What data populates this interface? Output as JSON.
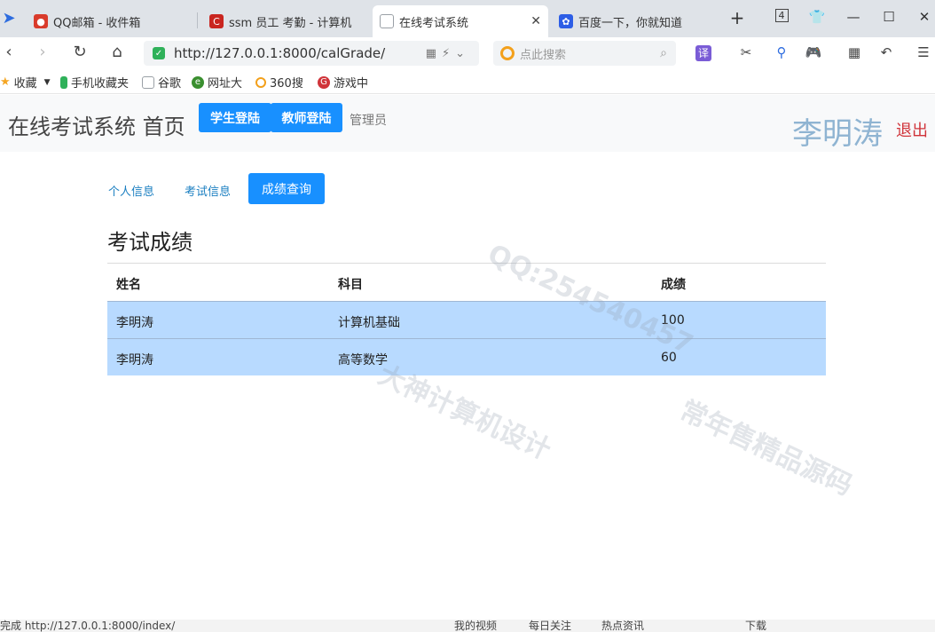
{
  "browser": {
    "tabs": [
      {
        "title": "QQ邮箱 - 收件箱",
        "icon": "qq-mail-icon",
        "color": "#d93b2b"
      },
      {
        "title": "ssm 员工 考勤 - 计算机",
        "icon": "csdn-icon",
        "color": "#c9251f"
      },
      {
        "title": "在线考试系统",
        "icon": "page-icon",
        "color": "#9aa0a6",
        "active": true
      },
      {
        "title": "百度一下，你就知道",
        "icon": "baidu-icon",
        "color": "#2d5ee6"
      }
    ],
    "tab_count": "4",
    "address_url": "http://127.0.0.1:8000/calGrade/",
    "search_placeholder": "点此搜索",
    "bookmarks": [
      {
        "label": "收藏",
        "icon": "star-icon",
        "color": "#f5a623"
      },
      {
        "label": "手机收藏夹",
        "icon": "phone-icon",
        "color": "#2fb15a"
      },
      {
        "label": "谷歌",
        "icon": "page-icon",
        "color": "#9aa0a6"
      },
      {
        "label": "网址大",
        "icon": "globe-icon",
        "color": "#3a8f2f"
      },
      {
        "label": "360搜",
        "icon": "360-icon",
        "color": "#f3a01b"
      },
      {
        "label": "游戏中",
        "icon": "game-icon",
        "color": "#d0343a"
      }
    ],
    "status_left": "完成 http://127.0.0.1:8000/index/",
    "status_items": [
      "我的视频",
      "每日关注",
      "热点资讯",
      "下载"
    ]
  },
  "site": {
    "brand": "在线考试系统 首页",
    "student_login": "学生登陆",
    "teacher_login": "教师登陆",
    "admin": "管理员",
    "username": "李明涛",
    "logout": "退出"
  },
  "subnav": {
    "profile": "个人信息",
    "exam_info": "考试信息",
    "grade_query": "成绩查询"
  },
  "grades": {
    "title": "考试成绩",
    "headers": [
      "姓名",
      "科目",
      "成绩"
    ],
    "rows": [
      [
        "李明涛",
        "计算机基础",
        "100"
      ],
      [
        "李明涛",
        "高等数学",
        "60"
      ]
    ]
  },
  "watermark": {
    "lines": [
      "QQ:254540457",
      "大神计算机设计",
      "常年售精品源码"
    ]
  },
  "colors": {
    "accent": "#1890ff",
    "row_highlight": "#b8daff",
    "username": "#8fb4d2",
    "logout": "#d0343a"
  }
}
